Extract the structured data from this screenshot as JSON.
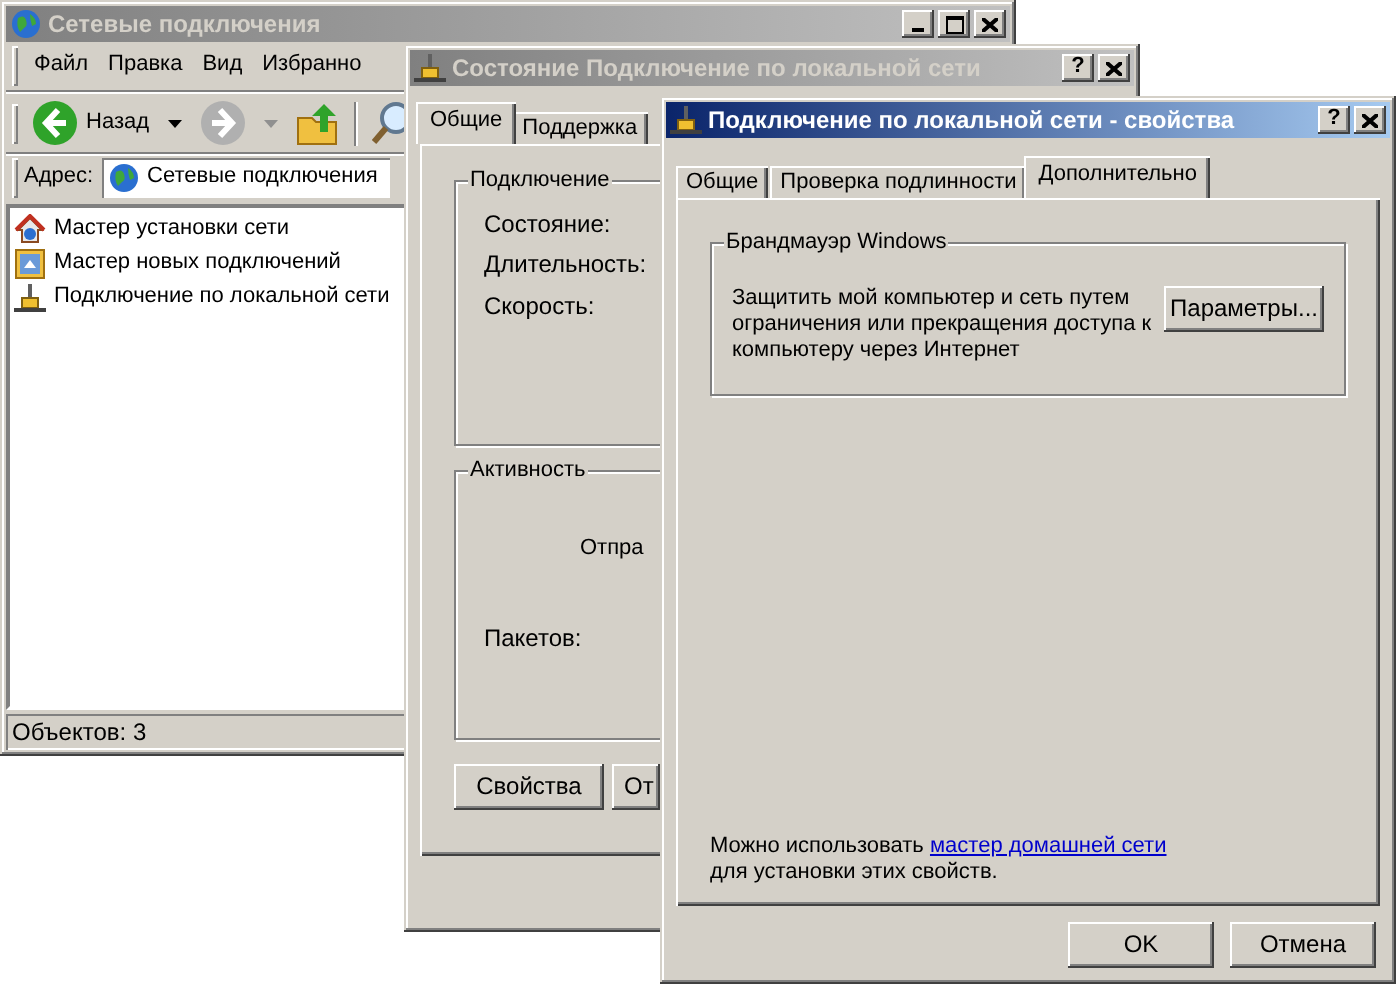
{
  "windows": [
    {
      "kind": "explorer",
      "title": "Сетевые подключения",
      "active": false,
      "menu": [
        "Файл",
        "Правка",
        "Вид",
        "Избранно"
      ],
      "back_label": "Назад",
      "address": {
        "label": "Адрес:",
        "value": "Сетевые подключения"
      },
      "items": [
        {
          "label": "Мастер установки сети"
        },
        {
          "label": "Мастер новых подключений"
        },
        {
          "label": "Подключение по локальной сети"
        }
      ],
      "status": "Объектов: 3"
    },
    {
      "kind": "status",
      "title": "Состояние Подключение по локальной сети",
      "active": false,
      "help": "?",
      "tabs": [
        {
          "label": "Общие",
          "selected": true
        },
        {
          "label": "Поддержка",
          "selected": false
        }
      ],
      "connection": {
        "title": "Подключение",
        "fields": [
          "Состояние:",
          "Длительность:",
          "Скорость:"
        ]
      },
      "activity": {
        "title": "Активность",
        "sent": "Отпра",
        "packets": "Пакетов:"
      },
      "buttons": [
        "Свойства",
        "От"
      ]
    },
    {
      "kind": "properties",
      "title": "Подключение по локальной сети - свойства",
      "active": true,
      "help": "?",
      "tabs": [
        {
          "label": "Общие",
          "selected": false
        },
        {
          "label": "Проверка подлинности",
          "selected": false
        },
        {
          "label": "Дополнительно",
          "selected": true
        }
      ],
      "firewall": {
        "title": "Брандмауэр Windows",
        "text": "Защитить мой компьютер и сеть путем\nограничения или прекращения доступа к\nкомпьютеру через Интернет",
        "button": "Параметры..."
      },
      "note": {
        "text": "Можно использовать",
        "link": "мастер домашней сети",
        "rest": "для установки этих свойств."
      },
      "buttons": [
        "OK",
        "Отмена"
      ]
    }
  ]
}
